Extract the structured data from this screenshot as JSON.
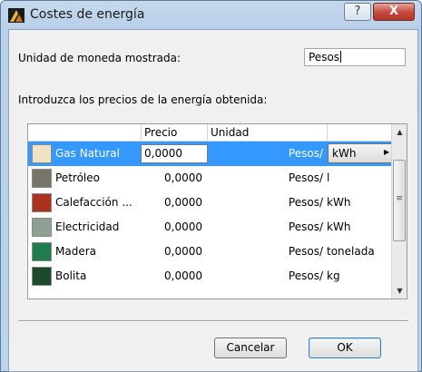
{
  "window": {
    "title": "Costes de energía",
    "help_glyph": "?",
    "close_glyph": "X"
  },
  "currency": {
    "label": "Unidad de moneda mostrada:",
    "value": "Pesos"
  },
  "instructions": "Introduzca los precios de la energía obtenida:",
  "table": {
    "headers": [
      "Precio",
      "Unidad"
    ],
    "rows": [
      {
        "name": "Gas Natural",
        "color": "#f2e2c4",
        "price": "0,0000",
        "unit_prefix": "Pesos/",
        "unit": "kWh",
        "selected": true
      },
      {
        "name": "Petróleo",
        "color": "#79746a",
        "price": "0,0000",
        "unit_prefix": "Pesos/",
        "unit": "l",
        "selected": false
      },
      {
        "name": "Calefacción ...",
        "color": "#a93221",
        "price": "0,0000",
        "unit_prefix": "Pesos/",
        "unit": "kWh",
        "selected": false
      },
      {
        "name": "Electricidad",
        "color": "#8e9f94",
        "price": "0,0000",
        "unit_prefix": "Pesos/",
        "unit": "kWh",
        "selected": false
      },
      {
        "name": "Madera",
        "color": "#1f7d4d",
        "price": "0,0000",
        "unit_prefix": "Pesos/",
        "unit": "tonelada",
        "selected": false
      },
      {
        "name": "Bolita",
        "color": "#1c4a2a",
        "price": "0,0000",
        "unit_prefix": "Pesos/",
        "unit": "kg",
        "selected": false
      }
    ]
  },
  "buttons": {
    "cancel": "Cancelar",
    "ok": "OK"
  },
  "colors": {
    "selection": "#3399ff",
    "title_bar": "#b9d0ea",
    "close_button": "#c3473b"
  },
  "icons": {
    "app": "energy-app-icon",
    "help": "help-icon",
    "close": "close-icon",
    "scroll_up": "scroll-up-icon",
    "scroll_down": "scroll-down-icon",
    "dropdown": "dropdown-arrow-icon"
  }
}
